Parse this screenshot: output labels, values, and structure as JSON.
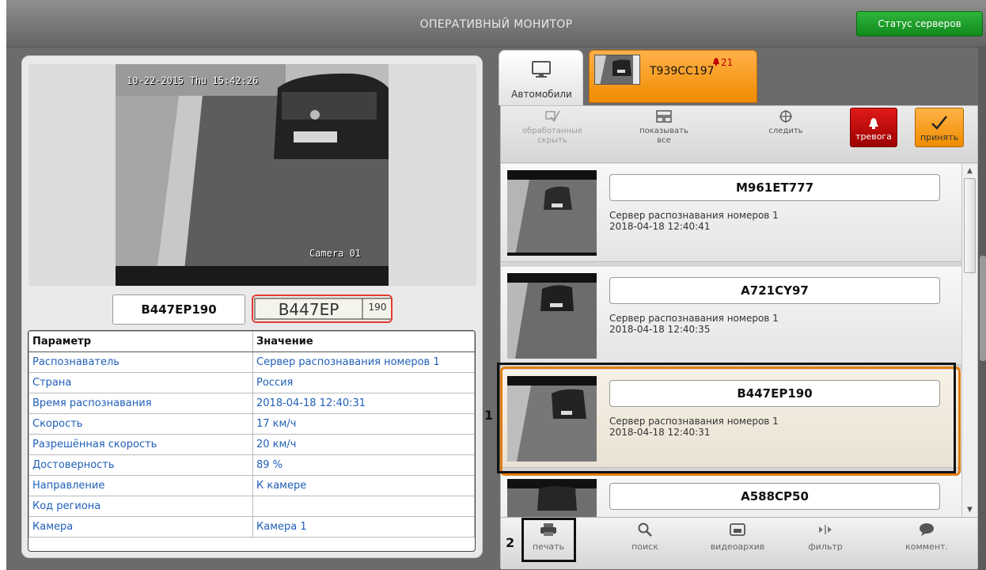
{
  "app": {
    "title": "ОПЕРАТИВНЫЙ МОНИТОР",
    "server_status_label": "Статус серверов"
  },
  "snapshot": {
    "timestamp": "10-22-2015 Thu 15:42:26",
    "camera_label": "Camera 01"
  },
  "plate": {
    "text": "B447EP190",
    "image_plate_text": "B447EP",
    "image_region_text": "190"
  },
  "params": {
    "headers": [
      "Параметр",
      "Значение"
    ],
    "rows": [
      {
        "name": "Распознаватель",
        "value": "Сервер распознавания номеров 1"
      },
      {
        "name": "Страна",
        "value": "Россия"
      },
      {
        "name": "Время распознавания",
        "value": "2018-04-18 12:40:31"
      },
      {
        "name": "Скорость",
        "value": "17 км/ч"
      },
      {
        "name": "Разрешённая скорость",
        "value": "20 км/ч"
      },
      {
        "name": "Достоверность",
        "value": "89 %"
      },
      {
        "name": "Направление",
        "value": "К камере"
      },
      {
        "name": "Код региона",
        "value": ""
      },
      {
        "name": "Камера",
        "value": "Камера 1"
      }
    ]
  },
  "tabs": {
    "cars_label": "Автомобили",
    "alarm_plate": "T939CC197",
    "alarm_count": "21"
  },
  "toolbar": {
    "hide_processed_label": "обработанные скрыть",
    "show_all_label": "показывать все",
    "follow_label": "следить",
    "alarm_label": "тревога",
    "accept_label": "принять"
  },
  "events": [
    {
      "plate": "M961ET777",
      "server": "Сервер распознавания номеров 1",
      "time": "2018-04-18 12:40:41"
    },
    {
      "plate": "A721CY97",
      "server": "Сервер распознавания номеров 1",
      "time": "2018-04-18 12:40:35"
    },
    {
      "plate": "B447EP190",
      "server": "Сервер распознавания номеров 1",
      "time": "2018-04-18 12:40:31"
    },
    {
      "plate": "A588CP50",
      "server": "",
      "time": ""
    }
  ],
  "bottom_bar": {
    "print_label": "печать",
    "search_label": "поиск",
    "archive_label": "видеоархив",
    "filter_label": "фильтр",
    "comment_label": "коммент."
  },
  "callouts": {
    "one": "1",
    "two": "2"
  },
  "colors": {
    "accent_orange": "#f08c00",
    "alarm_red": "#c00000",
    "status_green": "#1a9b27",
    "param_blue": "#1f5fb8"
  }
}
